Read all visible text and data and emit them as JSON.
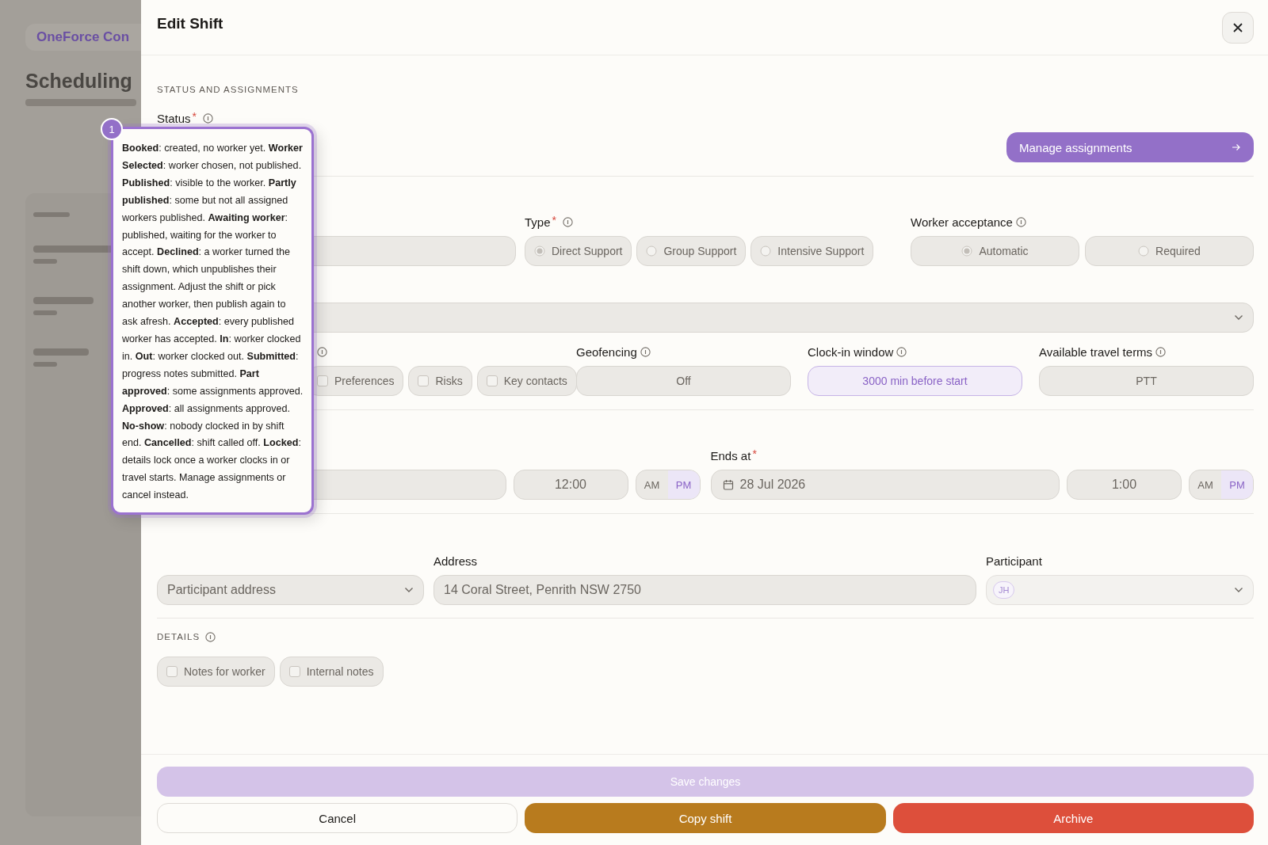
{
  "backdrop": {
    "brand": "OneForce Con",
    "heading": "Scheduling"
  },
  "drawer": {
    "title": "Edit Shift"
  },
  "status_section": {
    "heading": "STATUS AND ASSIGNMENTS",
    "status_label": "Status",
    "required_mark": "*",
    "manage_button": "Manage assignments"
  },
  "type": {
    "label": "Type",
    "required_mark": "*",
    "options": [
      {
        "label": "Direct Support",
        "selected": true
      },
      {
        "label": "Group Support",
        "selected": false
      },
      {
        "label": "Intensive Support",
        "selected": false
      }
    ]
  },
  "worker_acceptance": {
    "label": "Worker acceptance",
    "options": [
      {
        "label": "Automatic",
        "selected": true
      },
      {
        "label": "Required",
        "selected": false
      }
    ]
  },
  "checklist": [
    {
      "label": "Preferences",
      "checked": false
    },
    {
      "label": "Risks",
      "checked": false
    },
    {
      "label": "Key contacts",
      "checked": false
    }
  ],
  "geofencing": {
    "label": "Geofencing",
    "value": "Off"
  },
  "clock_in_window": {
    "label": "Clock-in window",
    "value": "3000 min before start"
  },
  "travel_terms": {
    "label": "Available travel terms",
    "value": "PTT"
  },
  "start": {
    "time": "12:00",
    "meridiem": [
      {
        "label": "AM",
        "selected": false
      },
      {
        "label": "PM",
        "selected": true
      }
    ]
  },
  "end": {
    "label": "Ends at",
    "required_mark": "*",
    "date": "28 Jul 2026",
    "time": "1:00",
    "meridiem": [
      {
        "label": "AM",
        "selected": false
      },
      {
        "label": "PM",
        "selected": true
      }
    ]
  },
  "location": {
    "address_source": "Participant address",
    "address_label": "Address",
    "address": "14 Coral Street, Penrith NSW 2750",
    "participant_label": "Participant",
    "participant_initials": "JH"
  },
  "details": {
    "heading": "DETAILS",
    "options": [
      {
        "label": "Notes for worker",
        "checked": false
      },
      {
        "label": "Internal notes",
        "checked": false
      }
    ]
  },
  "footer": {
    "save": {
      "label": "Save changes",
      "disabled": true
    },
    "buttons": [
      {
        "label": "Cancel",
        "kind": "secondary"
      },
      {
        "label": "Copy shift",
        "kind": "copy"
      },
      {
        "label": "Archive",
        "kind": "danger"
      }
    ]
  },
  "tooltip": {
    "badge": "1",
    "text": "**Booked**: created, no worker yet. **Worker Selected**: worker chosen, not published. **Published**: visible to the worker. **Partly published**: some but not all assigned workers published. **Awaiting worker**: published, waiting for the worker to accept. **Declined**: a worker turned the shift down, which unpublishes their assignment. Adjust the shift or pick another worker, then publish again to ask afresh. **Accepted**: every published worker has accepted. **In**: worker clocked in. **Out**: worker clocked out. **Submitted**: progress notes submitted. **Part approved**: some assignments approved. **Approved**: all assignments approved. **No-show**: nobody clocked in by shift end. **Cancelled**: shift called off. **Locked**: details lock once a worker clocks in or travel starts. Manage assignments or cancel instead."
  }
}
